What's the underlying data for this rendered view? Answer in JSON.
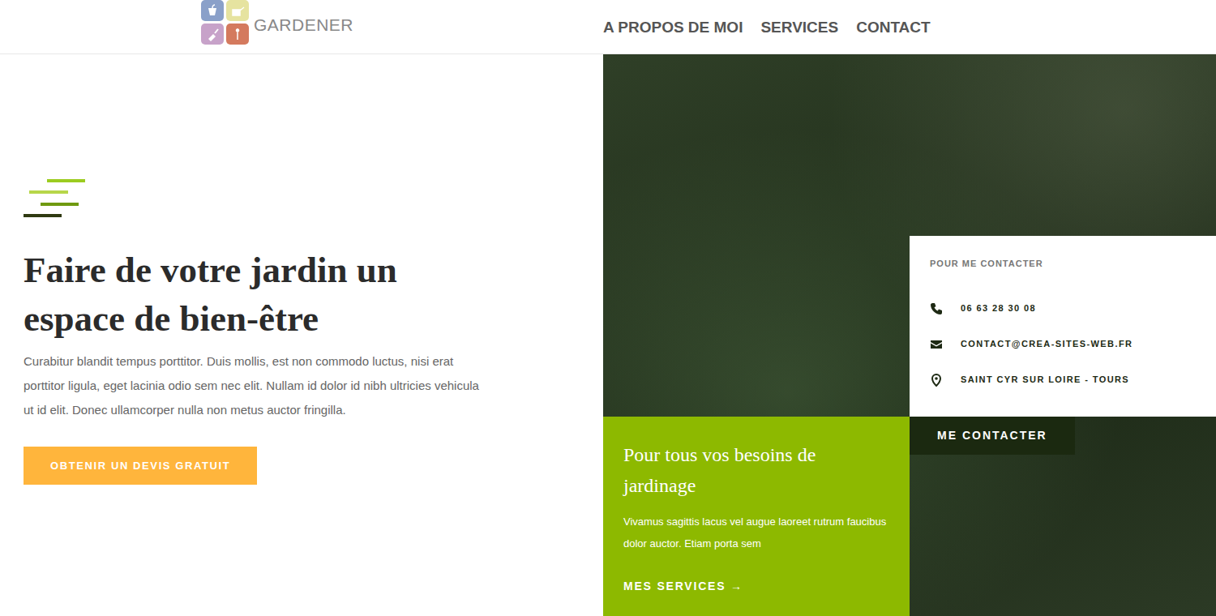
{
  "logo": {
    "text": "GARDENER"
  },
  "nav": [
    {
      "label": "A PROPOS DE MOI"
    },
    {
      "label": "SERVICES"
    },
    {
      "label": "CONTACT"
    }
  ],
  "hero": {
    "title": "Faire de votre jardin un espace de bien-être",
    "text": "Curabitur blandit tempus porttitor. Duis mollis, est non commodo luctus, nisi erat porttitor ligula, eget lacinia odio sem nec elit. Nullam id dolor id nibh ultricies vehicula ut id elit. Donec ullamcorper nulla non metus auctor fringilla.",
    "button": "OBTENIR UN DEVIS GRATUIT"
  },
  "contact_card": {
    "heading": "POUR ME CONTACTER",
    "items": [
      {
        "kind": "phone",
        "text": "06 63 28 30 08"
      },
      {
        "kind": "email",
        "text": "CONTACT@CREA-SITES-WEB.FR"
      },
      {
        "kind": "location",
        "text": "SAINT CYR SUR LOIRE - TOURS"
      }
    ],
    "button": "ME CONTACTER"
  },
  "services_box": {
    "title": "Pour tous vos besoins de jardinage",
    "text": "Vivamus sagittis lacus vel augue laoreet rutrum faucibus dolor auctor. Etiam porta sem",
    "link": "MES SERVICES →"
  }
}
